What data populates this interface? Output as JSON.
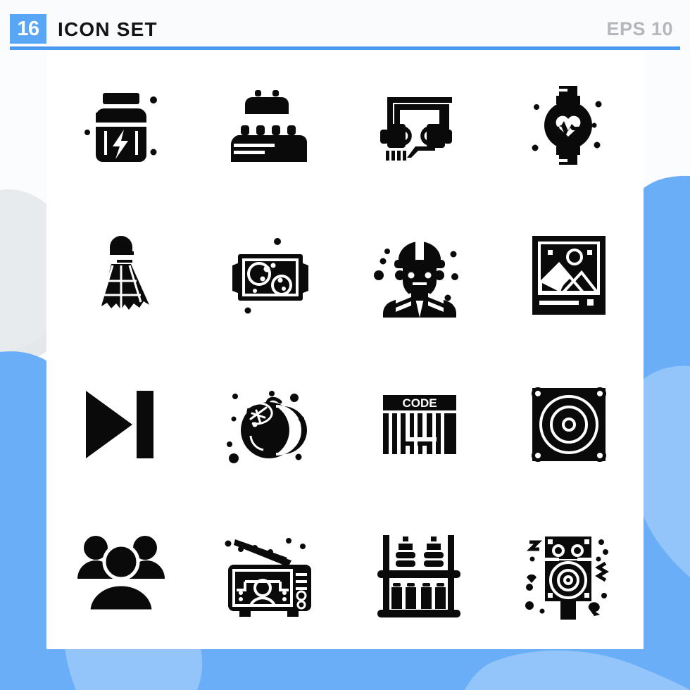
{
  "header": {
    "badge_count": "16",
    "title": "ICON SET",
    "format_label": "EPS 10"
  },
  "theme": {
    "accent": "#4a9bf0",
    "badge_bg": "#58a6f5",
    "blob_blue": "#6aaef7",
    "blob_light_blue": "#93c5fb",
    "blob_gray": "#e4e8ea",
    "icon_color": "#0a0a0a",
    "page_bg": "#fbfcfd",
    "card_bg": "#ffffff",
    "eps_color": "#b4b7bb"
  },
  "grid": {
    "columns": 4,
    "rows": 4,
    "total": 16
  },
  "icons": [
    {
      "index": 1,
      "row": 1,
      "col": 1,
      "name": "supplement-jar-icon",
      "label": "Supplement Jar"
    },
    {
      "index": 2,
      "row": 1,
      "col": 2,
      "name": "building-blocks-icon",
      "label": "Building Blocks"
    },
    {
      "index": 3,
      "row": 1,
      "col": 3,
      "name": "headset-icon",
      "label": "Headset"
    },
    {
      "index": 4,
      "row": 1,
      "col": 4,
      "name": "smartwatch-heartrate-icon",
      "label": "Smartwatch Heart Rate"
    },
    {
      "index": 5,
      "row": 2,
      "col": 1,
      "name": "shuttlecock-icon",
      "label": "Shuttlecock"
    },
    {
      "index": 6,
      "row": 2,
      "col": 2,
      "name": "vr-headset-space-icon",
      "label": "VR Headset Space"
    },
    {
      "index": 7,
      "row": 2,
      "col": 3,
      "name": "construction-worker-icon",
      "label": "Construction Worker"
    },
    {
      "index": 8,
      "row": 2,
      "col": 4,
      "name": "picture-frame-icon",
      "label": "Picture Frame"
    },
    {
      "index": 9,
      "row": 3,
      "col": 1,
      "name": "skip-forward-icon",
      "label": "Skip Forward"
    },
    {
      "index": 10,
      "row": 3,
      "col": 2,
      "name": "plum-fruit-icon",
      "label": "Plum Fruit"
    },
    {
      "index": 11,
      "row": 3,
      "col": 3,
      "name": "barcode-icon",
      "label": "Barcode",
      "text": "CODE"
    },
    {
      "index": 12,
      "row": 3,
      "col": 4,
      "name": "speaker-woofer-icon",
      "label": "Speaker Woofer"
    },
    {
      "index": 13,
      "row": 4,
      "col": 1,
      "name": "user-group-icon",
      "label": "User Group"
    },
    {
      "index": 14,
      "row": 4,
      "col": 2,
      "name": "television-news-icon",
      "label": "Television News"
    },
    {
      "index": 15,
      "row": 4,
      "col": 3,
      "name": "bottle-shelf-icon",
      "label": "Bottle Shelf"
    },
    {
      "index": 16,
      "row": 4,
      "col": 4,
      "name": "loudspeaker-stand-icon",
      "label": "Loudspeaker Stand"
    }
  ]
}
